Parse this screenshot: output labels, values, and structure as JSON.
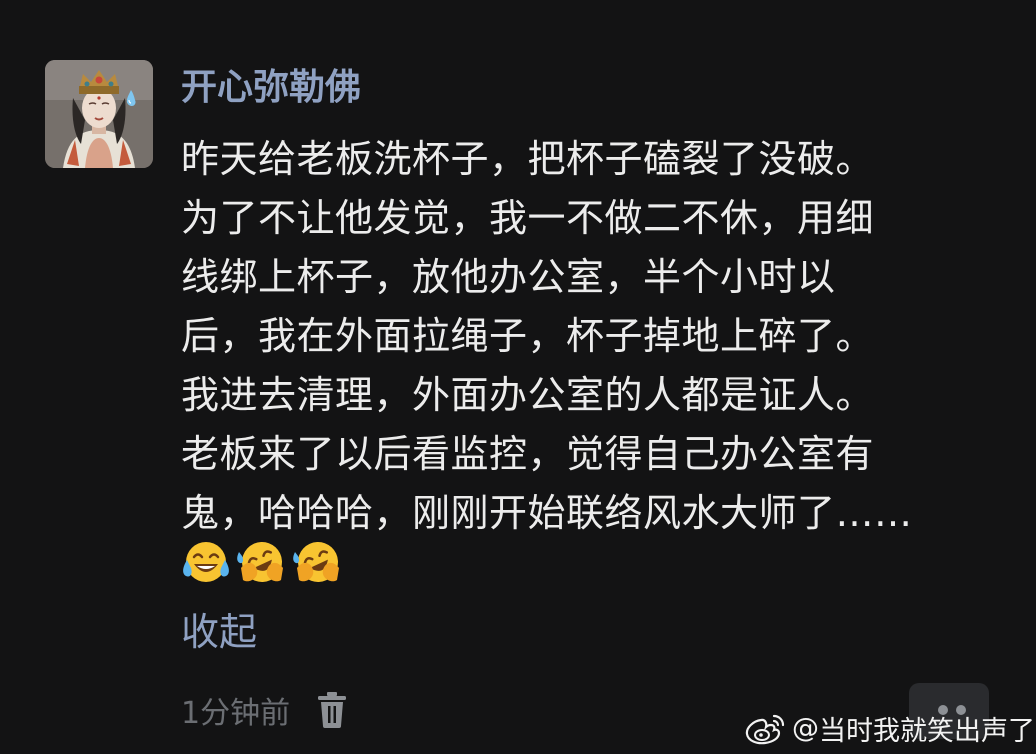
{
  "comment": {
    "username": "开心弥勒佛",
    "lines": [
      "昨天给老板洗杯子，把杯子磕裂了没破。",
      "为了不让他发觉，我一不做二不休，用细",
      "线绑上杯子，放他办公室，半个小时以",
      "后，我在外面拉绳子，杯子掉地上碎了。",
      "我进去清理，外面办公室的人都是证人。",
      "老板来了以后看监控，觉得自己办公室有",
      "鬼，哈哈哈，刚刚开始联络风水大师了……"
    ],
    "emojis": [
      "tears-of-joy-emoji",
      "rolling-laughing-emoji",
      "rolling-laughing-emoji"
    ],
    "collapse_label": "收起",
    "time": "1分钟前",
    "delete_icon": "trash-icon",
    "more_icon": "more-dots-icon"
  },
  "watermark": {
    "prefix": "@",
    "text": "当时我就笑出声了",
    "icon": "weibo-logo-icon"
  },
  "colors": {
    "background": "#131314",
    "username": "#8fa1c2",
    "text": "#ececec",
    "link": "#8fa1c2",
    "meta": "#6b6e73",
    "button_bg": "#2a2b2e"
  }
}
